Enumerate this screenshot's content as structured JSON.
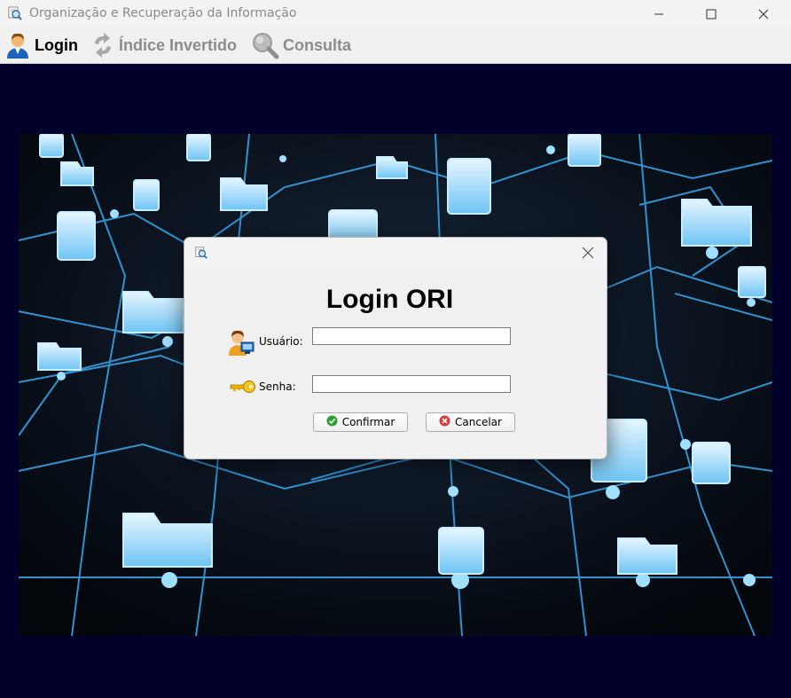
{
  "window": {
    "title": "Organização e Recuperação da Informação",
    "app_icon": "magnifier-document-icon",
    "controls": [
      "minimize-icon",
      "maximize-icon",
      "close-icon"
    ]
  },
  "menu": {
    "items": [
      {
        "label": "Login",
        "icon": "user-icon",
        "enabled": true
      },
      {
        "label": "Índice Invertido",
        "icon": "refresh-arrows-icon",
        "enabled": false
      },
      {
        "label": "Consulta",
        "icon": "search-icon",
        "enabled": false
      }
    ]
  },
  "login_dialog": {
    "heading": "Login ORI",
    "fields": [
      {
        "label": "Usuário:",
        "icon": "user-computer-icon",
        "value": ""
      },
      {
        "label": "Senha:",
        "icon": "key-icon",
        "value": ""
      }
    ],
    "buttons": [
      {
        "label": "Confirmar",
        "icon": "check-icon"
      },
      {
        "label": "Cancelar",
        "icon": "cancel-icon"
      }
    ]
  },
  "colors": {
    "desktop_background": "#00002a",
    "accent_glow": "#39b6ff",
    "confirm_green": "#2ea12e",
    "cancel_red": "#d83b3b",
    "key_gold": "#e8b400"
  }
}
